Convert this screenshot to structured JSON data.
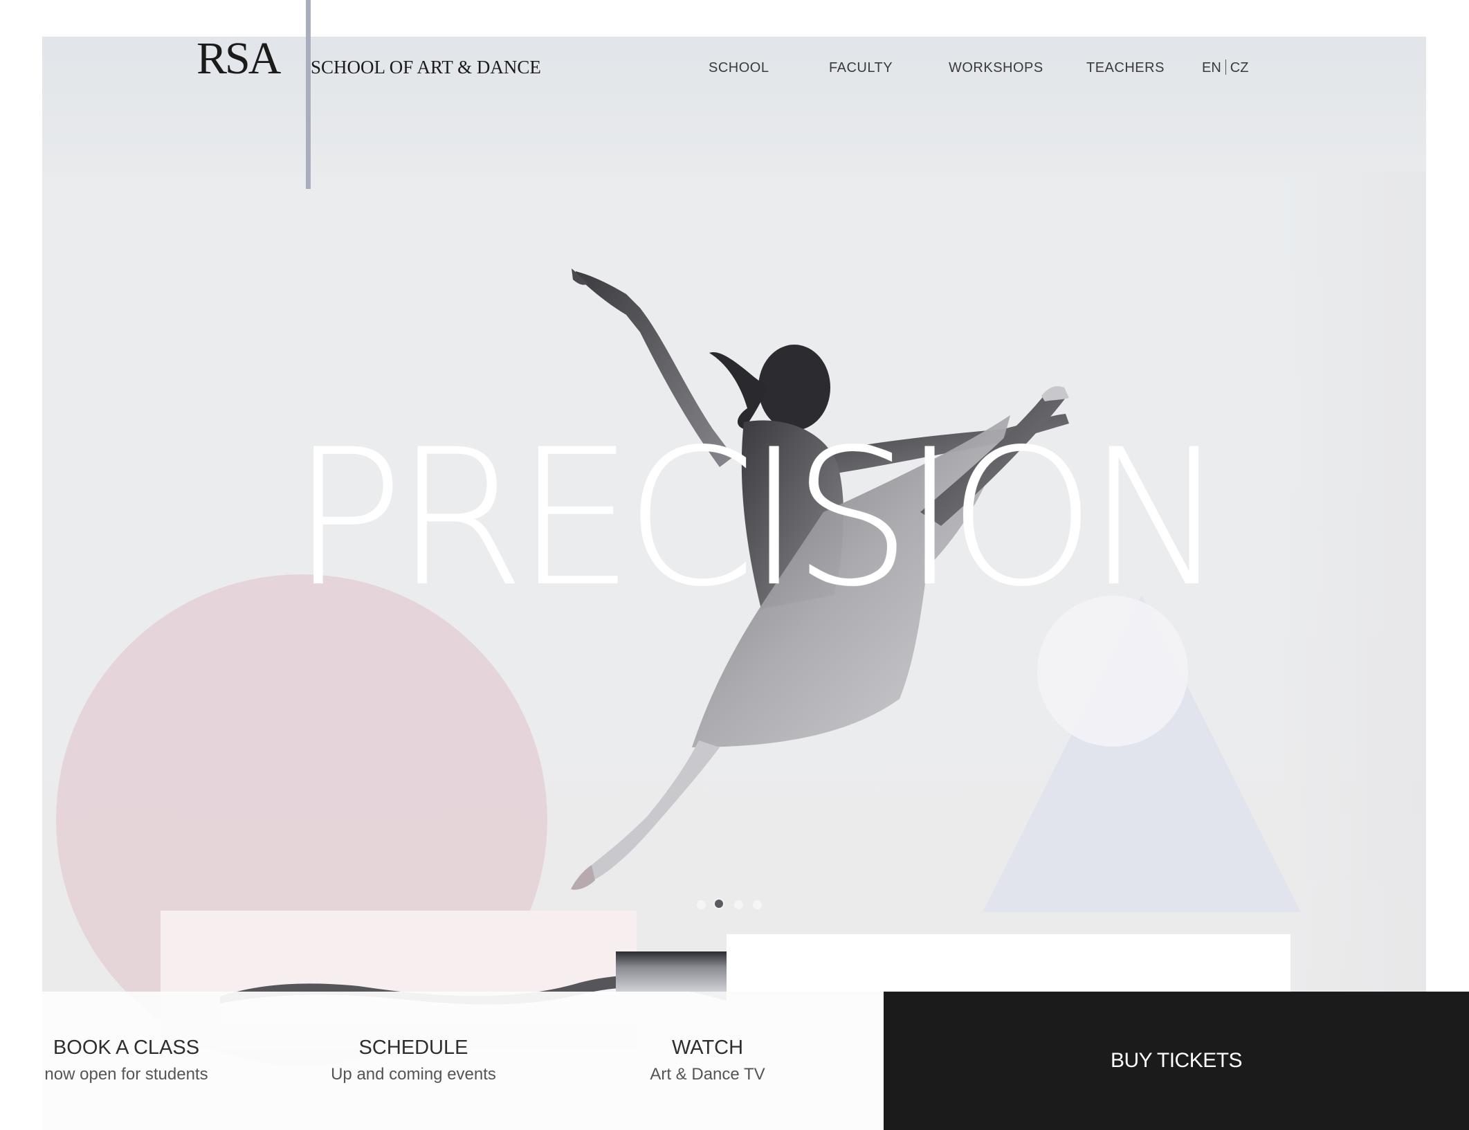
{
  "brand": {
    "logo": "RSA",
    "name": "SCHOOL OF ART & DANCE"
  },
  "nav": {
    "items": [
      "SCHOOL",
      "FACULTY",
      "WORKSHOPS",
      "TEACHERS"
    ],
    "lang_en": "EN",
    "lang_cz": "CZ"
  },
  "hero": {
    "headline": "PRECISION",
    "slides_total": 4,
    "slide_active": 2
  },
  "bottom": {
    "book": {
      "title": "BOOK A CLASS",
      "sub": "now open for students"
    },
    "schedule": {
      "title": "SCHEDULE",
      "sub": "Up and coming events"
    },
    "watch": {
      "title": "WATCH",
      "sub": "Art & Dance TV"
    },
    "buy": "BUY TICKETS"
  },
  "colors": {
    "pink_shape": "#e4d1d6",
    "dark_cta": "#1b1b1b",
    "divider": "#a8aebd"
  },
  "icons": {
    "slider_dots": "carousel-dots-icon"
  }
}
